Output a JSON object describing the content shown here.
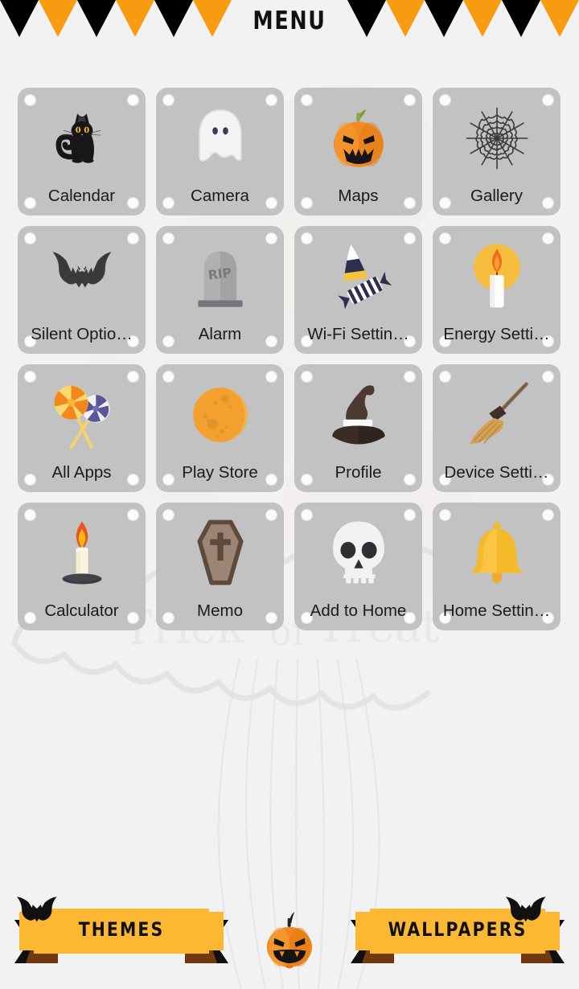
{
  "header": {
    "title": "MENU",
    "bunting_colors": [
      "#000000",
      "#f79b10"
    ],
    "flag_count_left": 6,
    "flag_count_right": 6
  },
  "theme": {
    "background": "#f2f2f3",
    "tile_background": "#c2c2c2",
    "accent_orange": "#f79b10",
    "ribbon_yellow": "#fcb833",
    "label_color": "#1b1b1b"
  },
  "background_art": {
    "watermark_text": "Trick or Treat",
    "description": "faint cloud banner with balloon strings"
  },
  "grid": {
    "columns": 4,
    "rows": 4,
    "items": [
      {
        "label": "Calendar",
        "icon": "black-cat-icon"
      },
      {
        "label": "Camera",
        "icon": "ghost-icon"
      },
      {
        "label": "Maps",
        "icon": "jack-o-lantern-icon"
      },
      {
        "label": "Gallery",
        "icon": "spiderweb-icon"
      },
      {
        "label": "Silent Optio…",
        "icon": "bat-icon"
      },
      {
        "label": "Alarm",
        "icon": "tombstone-icon"
      },
      {
        "label": "Wi-Fi Settin…",
        "icon": "candy-icon"
      },
      {
        "label": "Energy Setti…",
        "icon": "glowing-candle-icon"
      },
      {
        "label": "All Apps",
        "icon": "lollipops-icon"
      },
      {
        "label": "Play Store",
        "icon": "orange-moon-icon"
      },
      {
        "label": "Profile",
        "icon": "witch-hat-icon"
      },
      {
        "label": "Device Setti…",
        "icon": "broom-icon"
      },
      {
        "label": "Calculator",
        "icon": "candle-holder-icon"
      },
      {
        "label": "Memo",
        "icon": "coffin-icon"
      },
      {
        "label": "Add to Home",
        "icon": "skull-icon"
      },
      {
        "label": "Home Settin…",
        "icon": "bell-icon"
      }
    ],
    "tombstone_text": "RIP"
  },
  "bottom_bar": {
    "themes_label": "THEMES",
    "wallpapers_label": "WALLPAPERS",
    "home_icon": "pumpkin-home-icon"
  }
}
